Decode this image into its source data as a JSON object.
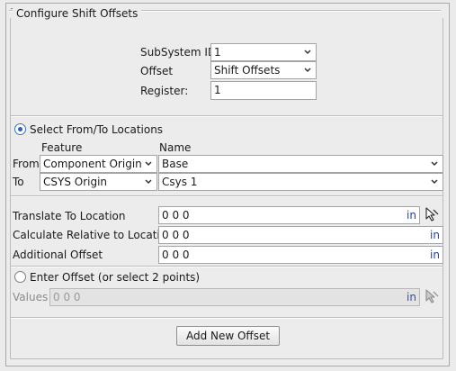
{
  "panel": {
    "title": "Configure Shift Offsets"
  },
  "top_fields": {
    "subsystem_label": "SubSystem ID",
    "subsystem_value": "1",
    "offset_label": "Offset",
    "offset_value": "Shift Offsets",
    "register_label": "Register:",
    "register_value": "1"
  },
  "from_to": {
    "radio_label": "Select From/To Locations",
    "radio_checked": true,
    "feature_header": "Feature",
    "name_header": "Name",
    "from_label": "From",
    "from_feature": "Component Origin",
    "from_name": "Base",
    "to_label": "To",
    "to_feature": "CSYS Origin",
    "to_name": "Csys 1"
  },
  "locations": {
    "translate_label": "Translate To Location",
    "translate_value": "0 0 0",
    "calc_label": "Calculate Relative to Location",
    "calc_value": "0 0 0",
    "additional_label": "Additional Offset",
    "additional_value": "0 0 0",
    "unit": "in"
  },
  "enter_offset": {
    "radio_label": "Enter Offset (or select 2 points)",
    "radio_checked": false,
    "values_label": "Values",
    "values_value": "0 0 0",
    "unit": "in"
  },
  "actions": {
    "add_label": "Add New Offset"
  },
  "icons": {
    "dropdown": "chevron-down-icon",
    "picker": "cursor-pick-icon"
  },
  "colors": {
    "unit_text": "#1f3fb3",
    "radio_dot": "#2a5fb8"
  }
}
